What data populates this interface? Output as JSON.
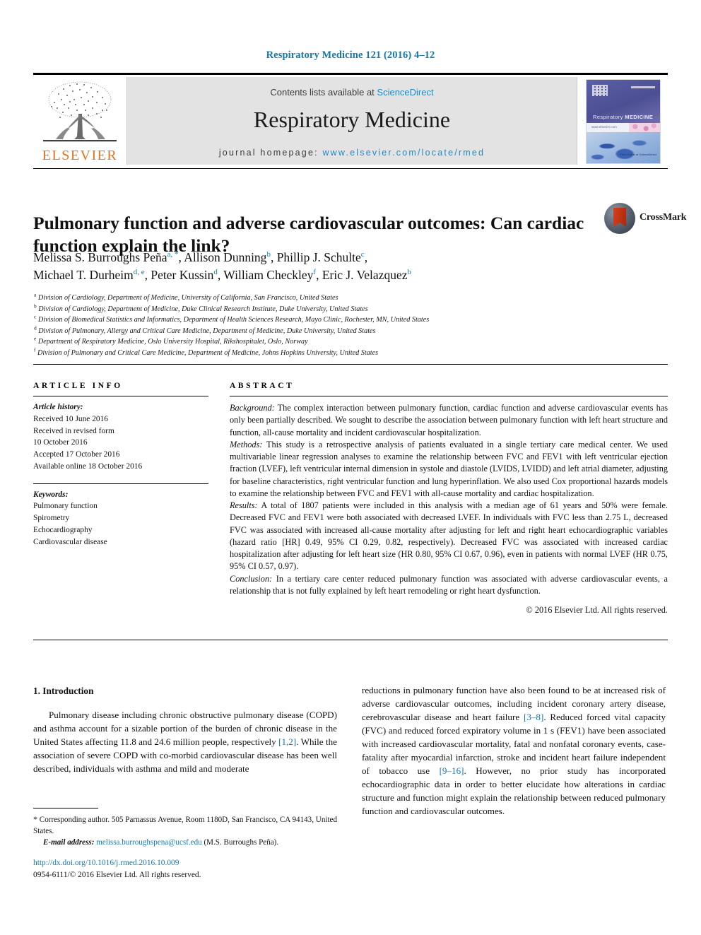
{
  "running_head": "Respiratory Medicine 121 (2016) 4–12",
  "masthead": {
    "contents_prefix": "Contents lists available at ",
    "sciencedirect": "ScienceDirect",
    "journal_title": "Respiratory Medicine",
    "homepage_prefix": "journal homepage: ",
    "homepage_url": "www.elsevier.com/locate/rmed",
    "publisher_wordmark": "ELSEVIER",
    "cover": {
      "title_light": "Respiratory ",
      "title_bold": "MEDICINE",
      "url": "www.elsevier.com",
      "caption": "Free on-line at\nScienceDirect"
    }
  },
  "badge": {
    "label": "CrossMark"
  },
  "article": {
    "title": "Pulmonary function and adverse cardiovascular outcomes: Can cardiac function explain the link?",
    "authors": [
      {
        "name": "Melissa S. Burroughs Peña",
        "marks": "a, *",
        "sep": ", "
      },
      {
        "name": "Allison Dunning",
        "marks": "b",
        "sep": ", "
      },
      {
        "name": "Phillip J. Schulte",
        "marks": "c",
        "sep": ","
      },
      {
        "name": "Michael T. Durheim",
        "marks": "d, e",
        "sep": ", "
      },
      {
        "name": "Peter Kussin",
        "marks": "d",
        "sep": ", "
      },
      {
        "name": "William Checkley",
        "marks": "f",
        "sep": ", "
      },
      {
        "name": "Eric J. Velazquez",
        "marks": "b",
        "sep": ""
      }
    ],
    "affiliations": [
      {
        "mark": "a",
        "text": "Division of Cardiology, Department of Medicine, University of California, San Francisco, United States"
      },
      {
        "mark": "b",
        "text": "Division of Cardiology, Department of Medicine, Duke Clinical Research Institute, Duke University, United States"
      },
      {
        "mark": "c",
        "text": "Division of Biomedical Statistics and Informatics, Department of Health Sciences Research, Mayo Clinic, Rochester, MN, United States"
      },
      {
        "mark": "d",
        "text": "Division of Pulmonary, Allergy and Critical Care Medicine, Department of Medicine, Duke University, United States"
      },
      {
        "mark": "e",
        "text": "Department of Respiratory Medicine, Oslo University Hospital, Rikshospitalet, Oslo, Norway"
      },
      {
        "mark": "f",
        "text": "Division of Pulmonary and Critical Care Medicine, Department of Medicine, Johns Hopkins University, United States"
      }
    ]
  },
  "article_info": {
    "heading": "ARTICLE INFO",
    "history_label": "Article history:",
    "history": [
      "Received 10 June 2016",
      "Received in revised form",
      "10 October 2016",
      "Accepted 17 October 2016",
      "Available online 18 October 2016"
    ],
    "keywords_label": "Keywords:",
    "keywords": [
      "Pulmonary function",
      "Spirometry",
      "Echocardiography",
      "Cardiovascular disease"
    ]
  },
  "abstract": {
    "heading": "ABSTRACT",
    "sections": [
      {
        "label": "Background:",
        "text": " The complex interaction between pulmonary function, cardiac function and adverse cardiovascular events has only been partially described. We sought to describe the association between pulmonary function with left heart structure and function, all-cause mortality and incident cardiovascular hospitalization."
      },
      {
        "label": "Methods:",
        "text": " This study is a retrospective analysis of patients evaluated in a single tertiary care medical center. We used multivariable linear regression analyses to examine the relationship between FVC and FEV1 with left ventricular ejection fraction (LVEF), left ventricular internal dimension in systole and diastole (LVIDS, LVIDD) and left atrial diameter, adjusting for baseline characteristics, right ventricular function and lung hyperinflation. We also used Cox proportional hazards models to examine the relationship between FVC and FEV1 with all-cause mortality and cardiac hospitalization."
      },
      {
        "label": "Results:",
        "text": " A total of 1807 patients were included in this analysis with a median age of 61 years and 50% were female. Decreased FVC and FEV1 were both associated with decreased LVEF. In individuals with FVC less than 2.75 L, decreased FVC was associated with increased all-cause mortality after adjusting for left and right heart echocardiographic variables (hazard ratio [HR] 0.49, 95% CI 0.29, 0.82, respectively). Decreased FVC was associated with increased cardiac hospitalization after adjusting for left heart size (HR 0.80, 95% CI 0.67, 0.96), even in patients with normal LVEF (HR 0.75, 95% CI 0.57, 0.97)."
      },
      {
        "label": "Conclusion:",
        "text": " In a tertiary care center reduced pulmonary function was associated with adverse cardiovascular events, a relationship that is not fully explained by left heart remodeling or right heart dysfunction."
      }
    ],
    "copyright": "© 2016 Elsevier Ltd. All rights reserved."
  },
  "introduction": {
    "heading": "1. Introduction",
    "left_paragraph_pre": "Pulmonary disease including chronic obstructive pulmonary disease (COPD) and asthma account for a sizable portion of the burden of chronic disease in the United States affecting 11.8 and 24.6 million people, respectively ",
    "left_ref": "[1,2]",
    "left_paragraph_post": ". While the association of severe COPD with co-morbid cardiovascular disease has been well described, individuals with asthma and mild and moderate",
    "right_part_1": "reductions in pulmonary function have also been found to be at increased risk of adverse cardiovascular outcomes, including incident coronary artery disease, cerebrovascular disease and heart failure ",
    "right_ref_1": "[3–8]",
    "right_part_2": ". Reduced forced vital capacity (FVC) and reduced forced expiratory volume in 1 s (FEV1) have been associated with increased cardiovascular mortality, fatal and nonfatal coronary events, case-fatality after myocardial infarction, stroke and incident heart failure independent of tobacco use ",
    "right_ref_2": "[9–16]",
    "right_part_3": ". However, no prior study has incorporated echocardiographic data in order to better elucidate how alterations in cardiac structure and function might explain the relationship between reduced pulmonary function and cardiovascular outcomes."
  },
  "footer": {
    "corresponding_star": "*",
    "corresponding_text": " Corresponding author. 505 Parnassus Avenue, Room 1180D, San Francisco, CA 94143, United States.",
    "email_label": "E-mail address:",
    "email": "melissa.burroughspena@ucsf.edu",
    "email_suffix": " (M.S. Burroughs Peña).",
    "doi": "http://dx.doi.org/10.1016/j.rmed.2016.10.009",
    "issn_line": "0954-6111/© 2016 Elsevier Ltd. All rights reserved."
  },
  "colors": {
    "link_blue": "#1379b0",
    "sciencedirect_blue": "#1a8cc8",
    "elsevier_orange": "#e8711a",
    "masthead_gray": "#e3e3e3"
  }
}
